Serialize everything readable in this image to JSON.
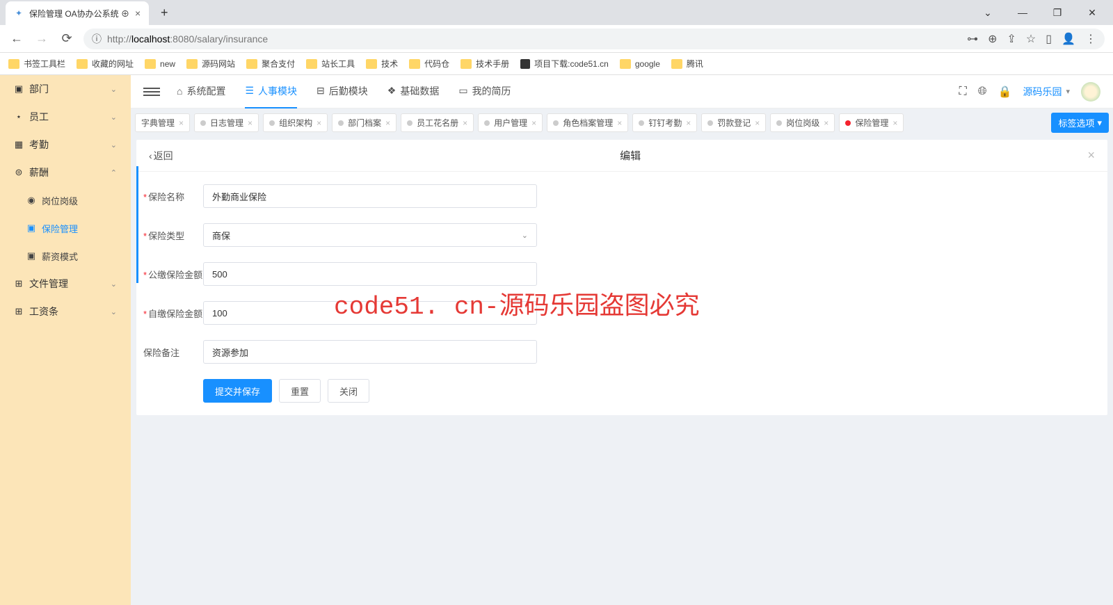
{
  "browser": {
    "tab_title": "保险管理 OA协办公系统 ⊕",
    "url_host": "localhost",
    "url_port": ":8080",
    "url_path": "/salary/insurance",
    "url_prefix": "http://"
  },
  "bookmarks": [
    {
      "label": "书签工具栏",
      "type": "folder"
    },
    {
      "label": "收藏的网址",
      "type": "folder"
    },
    {
      "label": "new",
      "type": "folder"
    },
    {
      "label": "源码网站",
      "type": "folder"
    },
    {
      "label": "聚合支付",
      "type": "folder"
    },
    {
      "label": "站长工具",
      "type": "folder"
    },
    {
      "label": "技术",
      "type": "folder"
    },
    {
      "label": "代码仓",
      "type": "folder"
    },
    {
      "label": "技术手册",
      "type": "folder"
    },
    {
      "label": "项目下载:code51.cn",
      "type": "link"
    },
    {
      "label": "google",
      "type": "folder"
    },
    {
      "label": "腾讯",
      "type": "folder"
    }
  ],
  "sidebar": {
    "items": [
      {
        "icon": "▣",
        "label": "部门",
        "expand": "⌄"
      },
      {
        "icon": "⋆",
        "label": "员工",
        "expand": "⌄"
      },
      {
        "icon": "▦",
        "label": "考勤",
        "expand": "⌄"
      },
      {
        "icon": "⊜",
        "label": "薪酬",
        "expand": "⌃"
      },
      {
        "icon": "⊞",
        "label": "文件管理",
        "expand": "⌄"
      },
      {
        "icon": "⊞",
        "label": "工资条",
        "expand": "⌄"
      }
    ],
    "sub": [
      {
        "icon": "◉",
        "label": "岗位岗级"
      },
      {
        "icon": "▣",
        "label": "保险管理",
        "active": true
      },
      {
        "icon": "▣",
        "label": "薪资模式"
      }
    ]
  },
  "topnav": [
    {
      "icon": "⌂",
      "label": "系统配置"
    },
    {
      "icon": "☰",
      "label": "人事模块",
      "active": true
    },
    {
      "icon": "⊟",
      "label": "后勤模块"
    },
    {
      "icon": "❖",
      "label": "基础数据"
    },
    {
      "icon": "▭",
      "label": "我的简历"
    }
  ],
  "topright": {
    "user": "源码乐园"
  },
  "tabs": [
    {
      "label": "字典管理"
    },
    {
      "label": "日志管理"
    },
    {
      "label": "组织架构"
    },
    {
      "label": "部门档案"
    },
    {
      "label": "员工花名册"
    },
    {
      "label": "用户管理"
    },
    {
      "label": "角色档案管理"
    },
    {
      "label": "钉钉考勤"
    },
    {
      "label": "罚款登记"
    },
    {
      "label": "岗位岗级"
    },
    {
      "label": "保险管理",
      "active": true
    }
  ],
  "tag_button": "标签选项",
  "panel": {
    "back": "返回",
    "title": "编辑",
    "fields": {
      "name_label": "保险名称",
      "name_value": "外勤商业保险",
      "type_label": "保险类型",
      "type_value": "商保",
      "company_amount_label": "公缴保险金额",
      "company_amount_value": "500",
      "self_amount_label": "自缴保险金额",
      "self_amount_value": "100",
      "remark_label": "保险备注",
      "remark_value": "资源参加"
    },
    "buttons": {
      "submit": "提交并保存",
      "reset": "重置",
      "close": "关闭"
    }
  },
  "watermark": "code51. cn-源码乐园盗图必究"
}
